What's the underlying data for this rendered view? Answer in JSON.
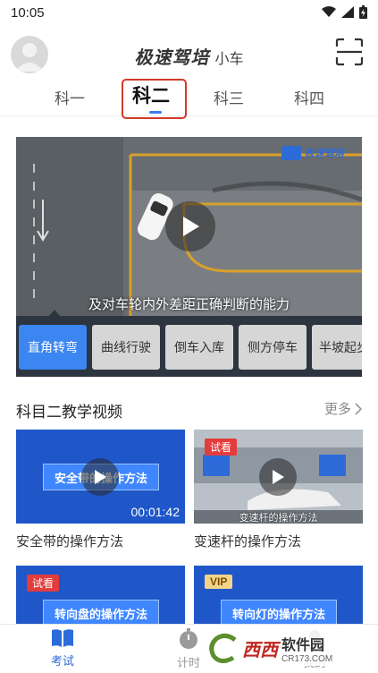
{
  "status_bar": {
    "time": "10:05"
  },
  "header": {
    "brand": "极速驾培",
    "subtitle": "小车"
  },
  "tabs": [
    {
      "label": "科一"
    },
    {
      "label": "科二"
    },
    {
      "label": "科三"
    },
    {
      "label": "科四"
    }
  ],
  "main_video": {
    "subtitle": "及对车轮内外差距正确判断的能力",
    "logo_text": "极速驾培"
  },
  "chips": [
    {
      "label": "直角转弯"
    },
    {
      "label": "曲线行驶"
    },
    {
      "label": "倒车入库"
    },
    {
      "label": "侧方停车"
    },
    {
      "label": "半坡起步"
    }
  ],
  "section": {
    "title": "科目二教学视频",
    "more": "更多"
  },
  "videos": [
    {
      "banner": "安全带的操作方法",
      "duration": "00:01:42",
      "caption": "安全带的操作方法"
    },
    {
      "tag": "试看",
      "caption": "变速杆的操作方法",
      "overlay": "变速杆的操作方法"
    },
    {
      "tag": "试看",
      "banner": "转向盘的操作方法"
    },
    {
      "tag": "VIP",
      "banner": "转向灯的操作方法"
    }
  ],
  "bottom_nav": [
    {
      "label": "考试"
    },
    {
      "label": "计时"
    },
    {
      "label": "我的"
    }
  ],
  "watermark": {
    "main": "西西",
    "title": "软件园",
    "site": "CR173.COM"
  },
  "colors": {
    "accent": "#3b7df0",
    "highlight": "#d23a2a",
    "chip_active": "#3b86f0"
  }
}
